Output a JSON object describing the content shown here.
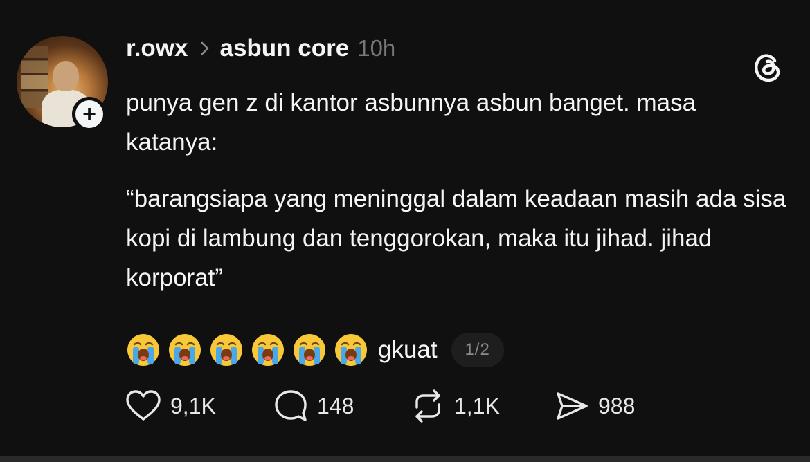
{
  "post": {
    "author": {
      "username": "r.owx",
      "avatar_icon": "profile-photo",
      "follow_icon": "plus-icon"
    },
    "community": "asbun core",
    "time": "10h",
    "body": [
      "punya gen z di kantor asbunnya asbun banget. masa katanya:",
      "“barangsiapa yang meninggal dalam keadaan masih ada sisa kopi di lambung dan tenggorokan, maka itu jihad. jihad korporat”"
    ],
    "emoji_line": {
      "emojis": [
        "😭",
        "😭",
        "😭",
        "😭",
        "😭",
        "😭"
      ],
      "text": "gkuat"
    },
    "page_indicator": "1/2",
    "actions": {
      "likes": "9,1K",
      "replies": "148",
      "reposts": "1,1K",
      "shares": "988"
    }
  },
  "theme": {
    "background": "#101010",
    "text": "#f3f5f7",
    "muted": "#777777"
  }
}
